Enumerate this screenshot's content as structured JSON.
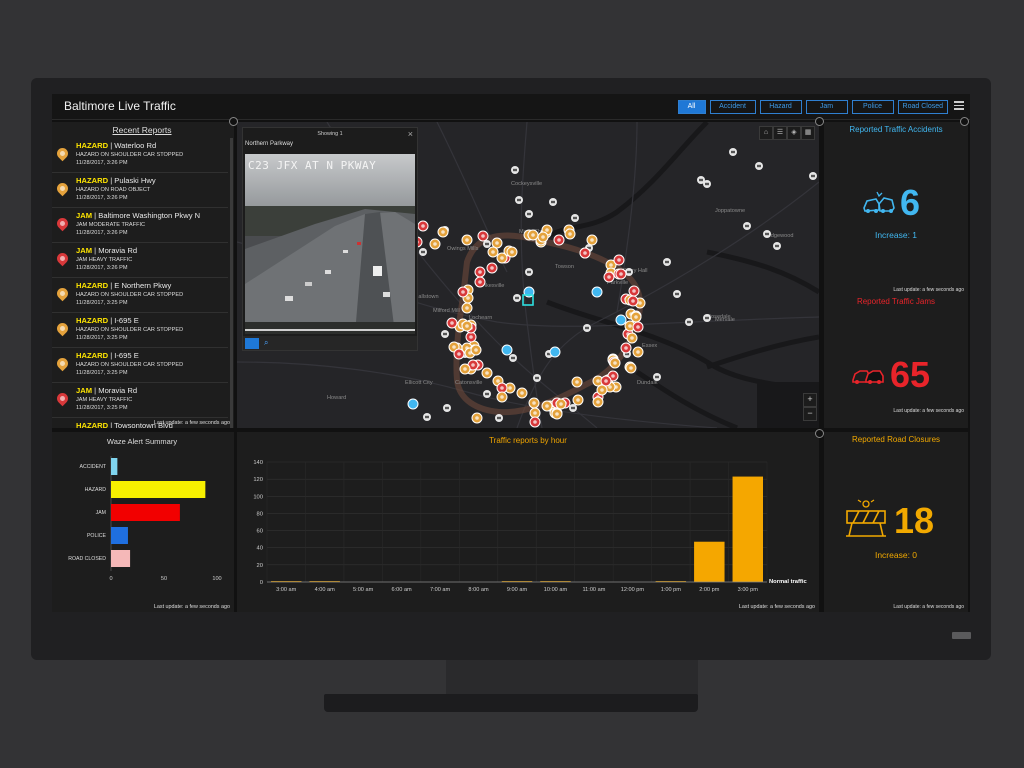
{
  "app": {
    "title": "Baltimore Live Traffic"
  },
  "filters": [
    {
      "label": "All",
      "active": true
    },
    {
      "label": "Accident",
      "active": false
    },
    {
      "label": "Hazard",
      "active": false
    },
    {
      "label": "Jam",
      "active": false
    },
    {
      "label": "Police",
      "active": false
    },
    {
      "label": "Road Closed",
      "active": false
    }
  ],
  "recent_reports": {
    "title": "Recent Reports",
    "last_update": "Last update: a few seconds ago",
    "items": [
      {
        "type": "HAZARD",
        "location": "| Waterloo Rd",
        "detail": "HAZARD ON SHOULDER CAR STOPPED",
        "time": "11/28/2017, 3:26 PM",
        "pin_color": "#e4a23c"
      },
      {
        "type": "HAZARD",
        "location": "| Pulaski Hwy",
        "detail": "HAZARD ON ROAD OBJECT",
        "time": "11/28/2017, 3:26 PM",
        "pin_color": "#e4a23c"
      },
      {
        "type": "JAM",
        "location": "| Baltimore Washington Pkwy N",
        "detail": "JAM MODERATE TRAFFIC",
        "time": "11/28/2017, 3:26 PM",
        "pin_color": "#d8383a"
      },
      {
        "type": "JAM",
        "location": "| Moravia Rd",
        "detail": "JAM HEAVY TRAFFIC",
        "time": "11/28/2017, 3:26 PM",
        "pin_color": "#d8383a"
      },
      {
        "type": "HAZARD",
        "location": "| E Northern Pkwy",
        "detail": "HAZARD ON SHOULDER CAR STOPPED",
        "time": "11/28/2017, 3:25 PM",
        "pin_color": "#e4a23c"
      },
      {
        "type": "HAZARD",
        "location": "| I-695 E",
        "detail": "HAZARD ON SHOULDER CAR STOPPED",
        "time": "11/28/2017, 3:25 PM",
        "pin_color": "#e4a23c"
      },
      {
        "type": "HAZARD",
        "location": "| I-695 E",
        "detail": "HAZARD ON SHOULDER CAR STOPPED",
        "time": "11/28/2017, 3:25 PM",
        "pin_color": "#e4a23c"
      },
      {
        "type": "JAM",
        "location": "| Moravia Rd",
        "detail": "JAM HEAVY TRAFFIC",
        "time": "11/28/2017, 3:25 PM",
        "pin_color": "#d8383a"
      },
      {
        "type": "HAZARD",
        "location": "| Towsontown Blvd",
        "detail": "",
        "time": "",
        "pin_color": "#e4a23c"
      }
    ]
  },
  "map": {
    "popup": {
      "header": "Showing 1",
      "name": "Northern Parkway",
      "camera_text": "C23 JFX AT N PKWAY"
    },
    "tools": [
      "home-icon",
      "list-icon",
      "layers-icon",
      "qr-icon"
    ],
    "zoom_in": "+",
    "zoom_out": "−",
    "places": [
      {
        "name": "Cockeysville"
      },
      {
        "name": "Mays Chapel"
      },
      {
        "name": "Joppatowne"
      },
      {
        "name": "Edgewood"
      },
      {
        "name": "Towson"
      },
      {
        "name": "Perry Hall"
      },
      {
        "name": "Parkville"
      },
      {
        "name": "Randallstown"
      },
      {
        "name": "Milford Mill"
      },
      {
        "name": "Pikesville"
      },
      {
        "name": "Rosedale"
      },
      {
        "name": "Essex"
      },
      {
        "name": "Dundalk"
      },
      {
        "name": "Ellicott City"
      },
      {
        "name": "Catonsville"
      },
      {
        "name": "Howard"
      },
      {
        "name": "Owings Mills"
      },
      {
        "name": "Lochearn"
      },
      {
        "name": "Mervale"
      }
    ]
  },
  "hourly_chart": {
    "title": "Traffic reports by hour",
    "last_update": "Last update: a few seconds ago"
  },
  "waze_chart": {
    "title": "Waze Alert Summary",
    "last_update": "Last update: a few seconds ago"
  },
  "stats": [
    {
      "title": "Reported Traffic Accidents",
      "value": "6",
      "increase": "Increase: 1",
      "last_update": "Last update: a few seconds ago",
      "color": "#41b7f0",
      "icon": "car-crash-icon"
    },
    {
      "title": "Reported Traffic Jams",
      "value": "65",
      "increase": "",
      "last_update": "Last update: a few seconds ago",
      "color": "#e8242a",
      "icon": "traffic-jam-icon"
    },
    {
      "title": "Reported Road Closures",
      "value": "18",
      "increase": "Increase: 0",
      "last_update": "Last update: a few seconds ago",
      "color": "#f2a900",
      "icon": "road-barrier-icon"
    }
  ],
  "chart_data": [
    {
      "type": "bar",
      "title": "Waze Alert Summary",
      "orientation": "horizontal",
      "categories": [
        "ACCIDENT",
        "HAZARD",
        "JAM",
        "POLICE",
        "ROAD CLOSED"
      ],
      "values": [
        6,
        89,
        65,
        16,
        18
      ],
      "colors": [
        "#7fd4ee",
        "#f7f000",
        "#f20000",
        "#1f6fe0",
        "#f5b8b8"
      ],
      "xlim": [
        0,
        100
      ],
      "xticks": [
        0,
        50,
        100
      ],
      "grid": false
    },
    {
      "type": "bar",
      "title": "Traffic reports by hour",
      "categories": [
        "3:00 am",
        "4:00 am",
        "5:00 am",
        "6:00 am",
        "7:00 am",
        "8:00 am",
        "9:00 am",
        "10:00 am",
        "11:00 am",
        "12:00 pm",
        "1:00 pm",
        "2:00 pm",
        "3:00 pm"
      ],
      "series": [
        {
          "name": "Normal traffic",
          "values": [
            1,
            1,
            0,
            0,
            0,
            0,
            1,
            1,
            0,
            0,
            1,
            47,
            123
          ]
        }
      ],
      "color": "#f5a700",
      "ylim": [
        0,
        140
      ],
      "yticks": [
        0,
        20,
        40,
        60,
        80,
        100,
        120,
        140
      ],
      "grid": true,
      "legend": "bottom-right"
    }
  ]
}
